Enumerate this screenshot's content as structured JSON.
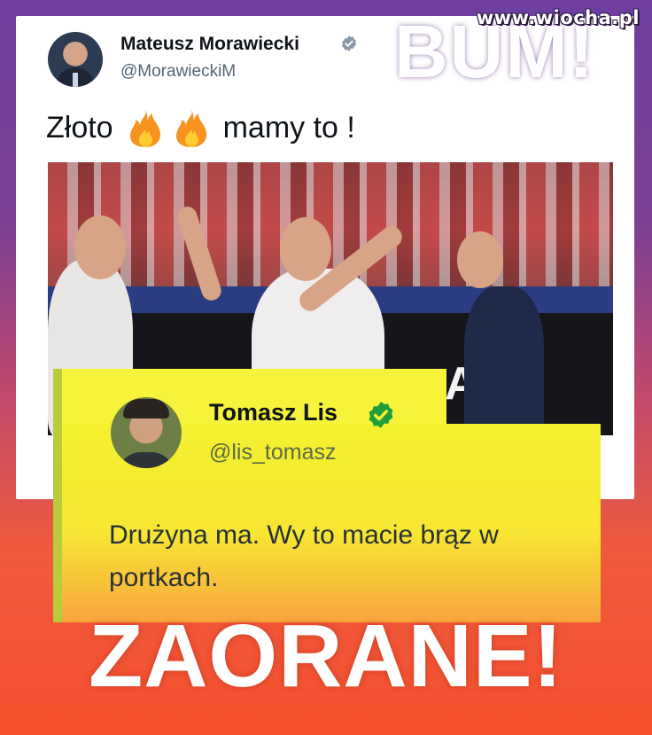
{
  "watermark": "www.wiocha.pl",
  "overlay_top": "BUM!",
  "overlay_bottom": "ZAORANE!",
  "tweet": {
    "author_name": "Mateusz Morawiecki",
    "author_handle": "@MorawieckiM",
    "text_before": "Złoto",
    "text_after": "mamy to !",
    "emoji": [
      "fire-emoji",
      "fire-emoji"
    ],
    "photo_board_text": "AIK"
  },
  "reply": {
    "author_name": "Tomasz Lis",
    "author_handle": "@lis_tomasz",
    "text": "Drużyna ma. Wy to macie brąz w portkach."
  },
  "colors": {
    "verified_gray": "#8b98a5",
    "verified_green": "#1f9e3a",
    "reply_bg": "#f4f12f",
    "bottom_orange": "#f4512f",
    "top_purple": "#6e3fa0"
  }
}
